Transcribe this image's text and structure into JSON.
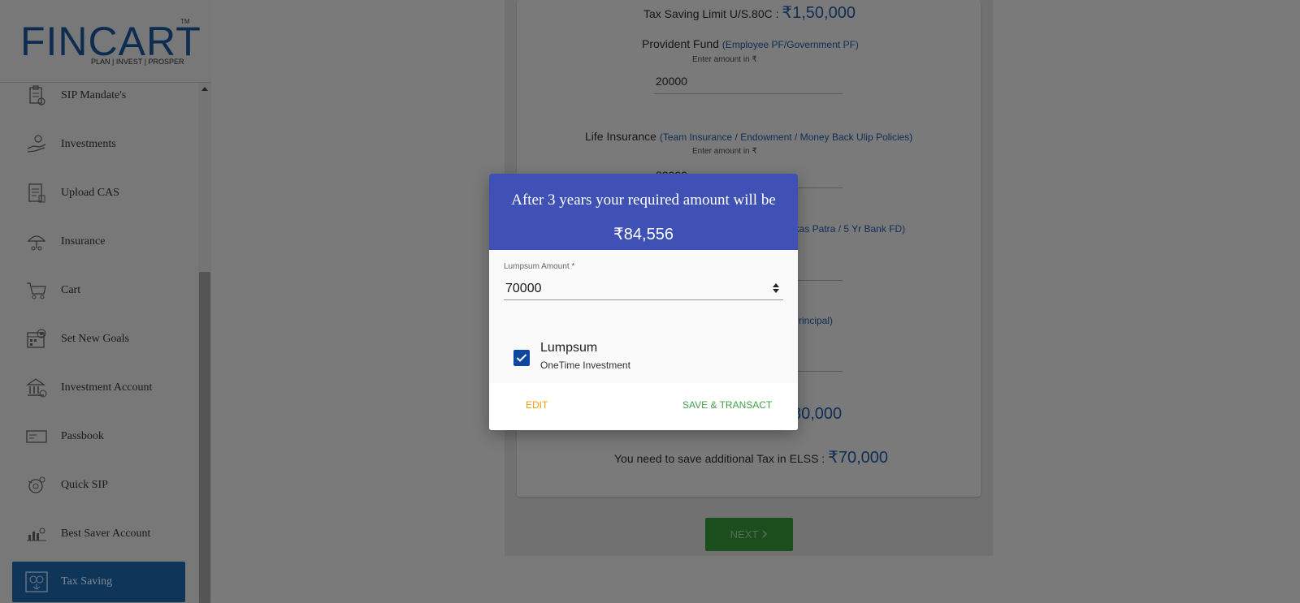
{
  "logo": {
    "text": "FINCART",
    "tm": "TM",
    "tagline": "PLAN | INVEST | PROSPER"
  },
  "sidebar": {
    "items": [
      {
        "label": "SIP Mandate's",
        "icon": "clipboard-icon"
      },
      {
        "label": "Investments",
        "icon": "hand-coin-icon"
      },
      {
        "label": "Upload CAS",
        "icon": "document-upload-icon"
      },
      {
        "label": "Insurance",
        "icon": "umbrella-icon"
      },
      {
        "label": "Cart",
        "icon": "cart-icon"
      },
      {
        "label": "Set New Goals",
        "icon": "goal-calendar-icon"
      },
      {
        "label": "Investment Account",
        "icon": "bank-icon"
      },
      {
        "label": "Passbook",
        "icon": "passbook-icon"
      },
      {
        "label": "Quick SIP",
        "icon": "quick-sip-icon"
      },
      {
        "label": "Best Saver Account",
        "icon": "saver-icon"
      },
      {
        "label": "Tax Saving",
        "icon": "tax-saving-icon",
        "active": true
      }
    ]
  },
  "background_form": {
    "limit_label": "Tax Saving Limit U/S.80C :",
    "limit_value": "₹1,50,000",
    "pf_label": "Provident Fund",
    "pf_hint": "(Employee PF/Government PF)",
    "enter_amount": "Enter amount in ₹",
    "pf_value": "20000",
    "li_label": "Life Insurance",
    "li_hint": "(Team Insurance / Endowment / Money Back Ulip Policies)",
    "li_value": "80000",
    "third_hint": "ikas Patra / 5 Yr Bank FD)",
    "fourth_hint": "Principal)",
    "partial_total": "80,000",
    "elss_label": "You need to save additional Tax in ELSS :",
    "elss_value": "₹70,000",
    "next_label": "NEXT"
  },
  "modal": {
    "title": "After 3 years your required amount will be",
    "amount": "₹84,556",
    "field_label": "Lumpsum Amount *",
    "field_value": "70000",
    "option_title": "Lumpsum",
    "option_subtitle": "OneTime Investment",
    "option_checked": true,
    "edit_label": "EDIT",
    "save_label": "SAVE & TRANSACT",
    "colors": {
      "header": "#3f51b5",
      "edit": "#f59e00",
      "save": "#43a047",
      "checkbox": "#0d47a1"
    }
  }
}
